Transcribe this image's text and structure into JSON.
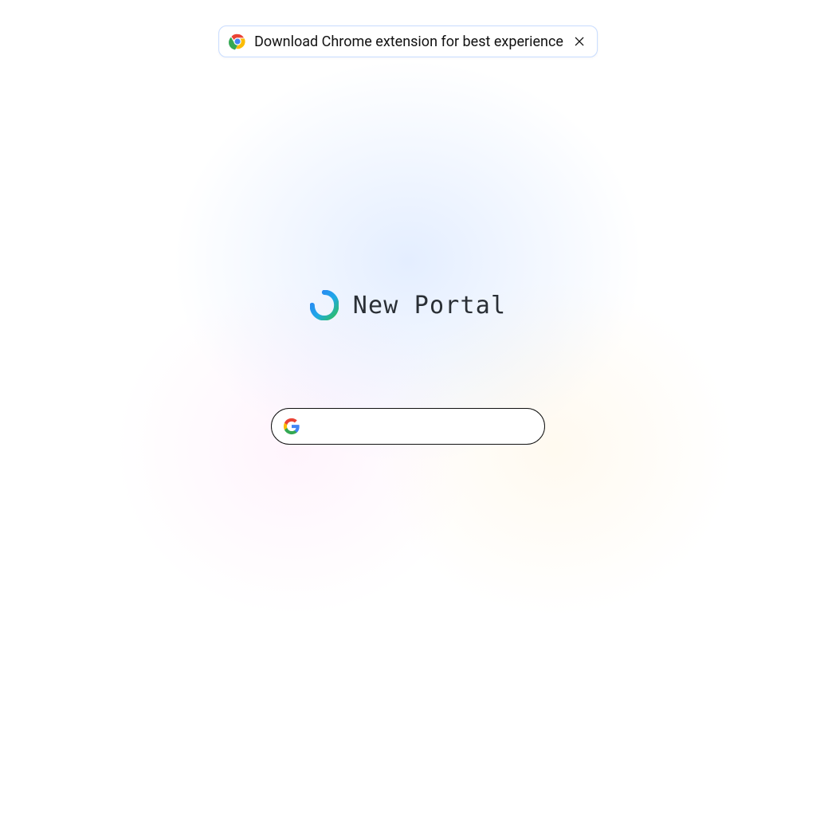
{
  "banner": {
    "text": "Download Chrome extension for best experience"
  },
  "title": "New Portal",
  "search": {
    "value": "",
    "placeholder": ""
  }
}
